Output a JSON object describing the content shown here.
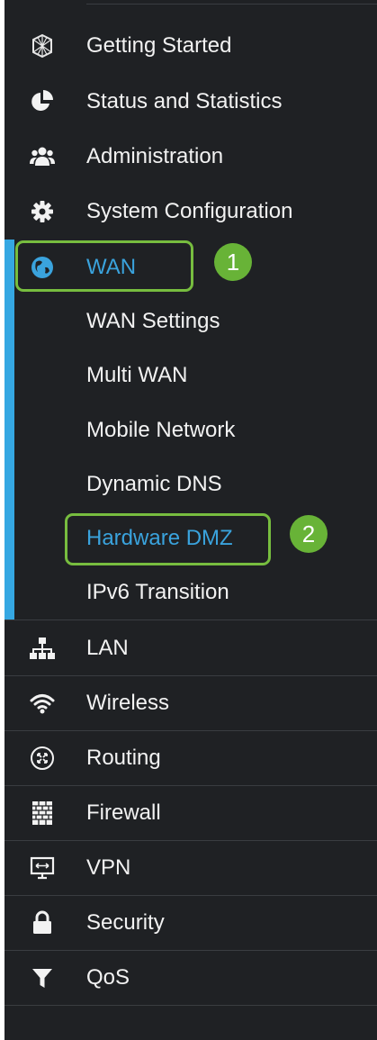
{
  "menu": {
    "getting_started": {
      "label": "Getting Started",
      "icon": "getting-started-icon"
    },
    "status": {
      "label": "Status and Statistics",
      "icon": "pie-chart-icon"
    },
    "administration": {
      "label": "Administration",
      "icon": "users-icon"
    },
    "system_config": {
      "label": "System Configuration",
      "icon": "gear-icon"
    },
    "wan": {
      "label": "WAN",
      "icon": "globe-icon",
      "expanded": true,
      "subitems": [
        {
          "label": "WAN Settings"
        },
        {
          "label": "Multi WAN"
        },
        {
          "label": "Mobile Network"
        },
        {
          "label": "Dynamic DNS"
        },
        {
          "label": "Hardware DMZ",
          "active": true
        },
        {
          "label": "IPv6 Transition"
        }
      ]
    },
    "lan": {
      "label": "LAN",
      "icon": "network-icon"
    },
    "wireless": {
      "label": "Wireless",
      "icon": "wifi-icon"
    },
    "routing": {
      "label": "Routing",
      "icon": "routing-icon"
    },
    "firewall": {
      "label": "Firewall",
      "icon": "firewall-icon"
    },
    "vpn": {
      "label": "VPN",
      "icon": "vpn-icon"
    },
    "security": {
      "label": "Security",
      "icon": "lock-icon"
    },
    "qos": {
      "label": "QoS",
      "icon": "filter-icon"
    }
  },
  "callouts": {
    "step1": "1",
    "step2": "2"
  },
  "colors": {
    "sidebar_bg": "#1f2124",
    "accent_blue": "#35a7e2",
    "active_text": "#3aa3dd",
    "highlight_green": "#77bd3f",
    "badge_green": "#68b337"
  }
}
